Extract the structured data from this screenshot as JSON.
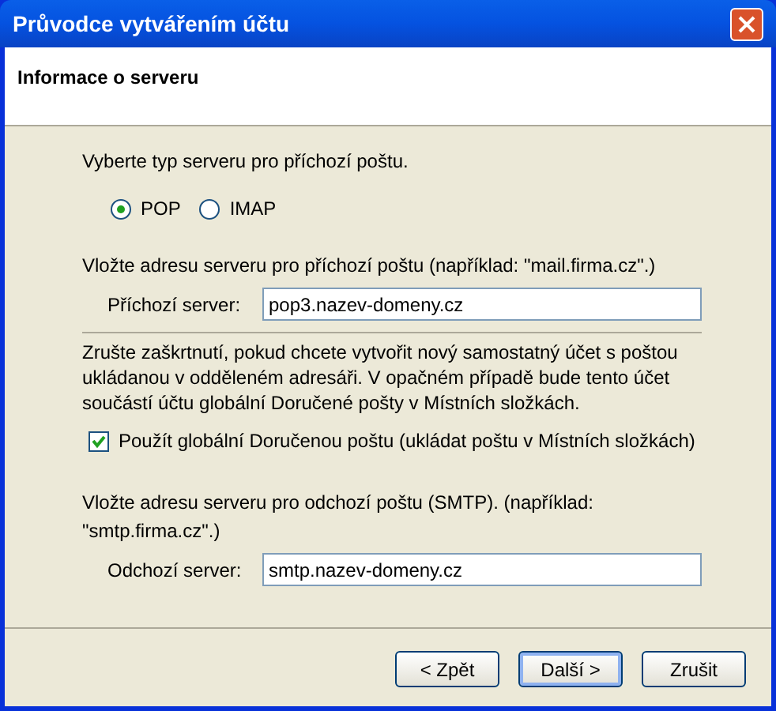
{
  "window": {
    "title": "Průvodce vytvářením účtu"
  },
  "header": {
    "title": "Informace o serveru"
  },
  "incoming_type": {
    "prompt": "Vyberte typ serveru pro příchozí poštu.",
    "options": [
      {
        "label": "POP",
        "selected": true
      },
      {
        "label": "IMAP",
        "selected": false
      }
    ]
  },
  "incoming_server": {
    "prompt": "Vložte adresu serveru pro příchozí poštu (například: \"mail.firma.cz\".)",
    "label": "Příchozí server:",
    "value": "pop3.nazev-domeny.cz"
  },
  "global_inbox": {
    "note": "Zrušte zaškrtnutí, pokud chcete vytvořit nový samostatný účet s poštou ukládanou v odděleném adresáři. V opačném případě bude tento účet součástí účtu globální Doručené pošty v Místních složkách.",
    "label": "Použít globální Doručenou poštu (ukládat poštu v Místních složkách)",
    "checked": true
  },
  "outgoing_server": {
    "prompt": "Vložte adresu serveru pro odchozí poštu (SMTP). (například: \"smtp.firma.cz\".)",
    "label": "Odchozí server:",
    "value": "smtp.nazev-domeny.cz"
  },
  "buttons": [
    {
      "label": "< Zpět",
      "selected": false
    },
    {
      "label": "Další >",
      "selected": true
    },
    {
      "label": "Zrušit",
      "selected": false
    }
  ]
}
